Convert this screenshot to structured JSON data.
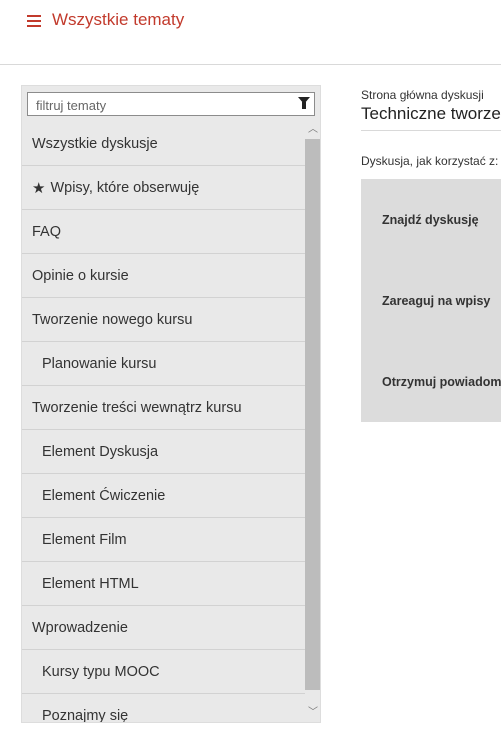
{
  "header": {
    "title": "Wszystkie tematy"
  },
  "sidebar": {
    "filter_placeholder": "filtruj tematy",
    "items": [
      {
        "label": "Wszystkie dyskusje",
        "level": 0
      },
      {
        "label": "Wpisy, które obserwuję",
        "level": 0,
        "icon": "star-icon"
      },
      {
        "label": "FAQ",
        "level": 0
      },
      {
        "label": "Opinie o kursie",
        "level": 0
      },
      {
        "label": "Tworzenie nowego kursu",
        "level": 0
      },
      {
        "label": "Planowanie kursu",
        "level": 1
      },
      {
        "label": "Tworzenie treści wewnątrz kursu",
        "level": 0
      },
      {
        "label": "Element Dyskusja",
        "level": 1
      },
      {
        "label": "Element Ćwiczenie",
        "level": 1
      },
      {
        "label": "Element Film",
        "level": 1
      },
      {
        "label": "Element HTML",
        "level": 1
      },
      {
        "label": "Wprowadzenie",
        "level": 0
      },
      {
        "label": "Kursy typu MOOC",
        "level": 1
      },
      {
        "label": "Poznajmy się",
        "level": 1
      }
    ]
  },
  "main": {
    "breadcrumb": "Strona główna dyskusji",
    "title": "Techniczne tworzen",
    "howto": "Dyskusja, jak korzystać z:",
    "steps": [
      "Znajdź dyskusję",
      "Zareaguj na wpisy",
      "Otrzymuj powiadom"
    ]
  },
  "colors": {
    "accent": "#c23a2c",
    "sidebar_bg": "#e9e9e9",
    "panel_bg": "#dcdcdc"
  }
}
